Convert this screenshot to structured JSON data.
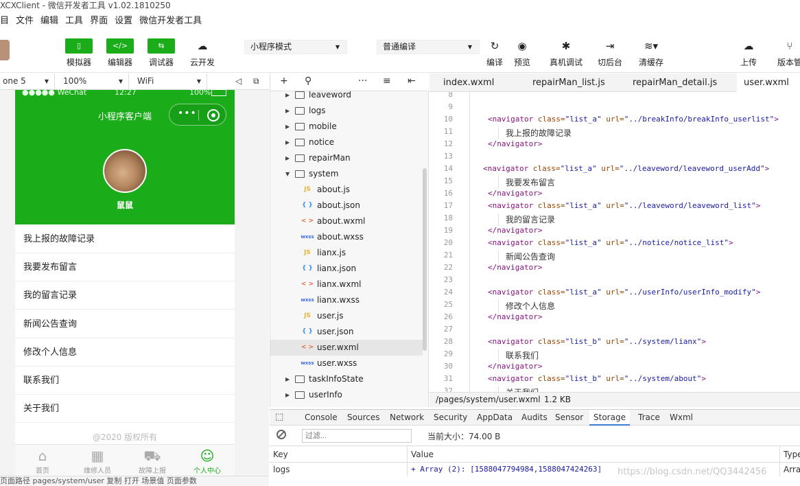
{
  "window": {
    "title": "XCXClient - 微信开发者工具 v1.02.1810250"
  },
  "menu": [
    "目",
    "文件",
    "编辑",
    "工具",
    "界面",
    "设置",
    "微信开发者工具"
  ],
  "toolbar": {
    "simulator": "模拟器",
    "editor": "编辑器",
    "debugger": "调试器",
    "cloud": "云开发",
    "mode_select": "小程序模式",
    "compile_select": "普通编译",
    "compile": "编译",
    "preview": "预览",
    "remote_debug": "真机调试",
    "background": "切后台",
    "clear_cache": "清缓存",
    "upload": "上传",
    "version": "版本管"
  },
  "simbar": {
    "device": "one 5",
    "zoom": "100%",
    "network": "WiFi"
  },
  "phone": {
    "status_left": "●●●●● WeChat",
    "status_time": "12:27",
    "status_battery": "100%",
    "nav_title": "小程序客户端",
    "user_name": "鼠鼠",
    "menu_items": [
      "我上报的故障记录",
      "我要发布留言",
      "我的留言记录",
      "新闻公告查询",
      "修改个人信息",
      "联系我们",
      "关于我们"
    ],
    "copyright": "@2020 版权所有",
    "tabs": [
      "首页",
      "维修人员",
      "故障上报",
      "个人中心"
    ]
  },
  "bottom_status": "页面路径  pages/system/user  复制  打开      场景值      页面参数",
  "tree": {
    "rows": [
      {
        "name": "leaveword",
        "type": "folder"
      },
      {
        "name": "logs",
        "type": "folder"
      },
      {
        "name": "mobile",
        "type": "folder"
      },
      {
        "name": "notice",
        "type": "folder"
      },
      {
        "name": "repairMan",
        "type": "folder"
      },
      {
        "name": "system",
        "type": "folder-open"
      },
      {
        "name": "about.js",
        "type": "js"
      },
      {
        "name": "about.json",
        "type": "json"
      },
      {
        "name": "about.wxml",
        "type": "wxml"
      },
      {
        "name": "about.wxss",
        "type": "wxss"
      },
      {
        "name": "lianx.js",
        "type": "js"
      },
      {
        "name": "lianx.json",
        "type": "json"
      },
      {
        "name": "lianx.wxml",
        "type": "wxml"
      },
      {
        "name": "lianx.wxss",
        "type": "wxss"
      },
      {
        "name": "user.js",
        "type": "js"
      },
      {
        "name": "user.json",
        "type": "json"
      },
      {
        "name": "user.wxml",
        "type": "wxml"
      },
      {
        "name": "user.wxss",
        "type": "wxss"
      },
      {
        "name": "taskInfoState",
        "type": "folder"
      },
      {
        "name": "userInfo",
        "type": "folder"
      }
    ],
    "selected": "user.wxml"
  },
  "editor": {
    "tabs": [
      "index.wxml",
      "repairMan_list.js",
      "repairMan_detail.js",
      "user.wxml"
    ],
    "active_tab": "user.wxml",
    "lines": [
      {
        "n": "8",
        "kind": "blank"
      },
      {
        "n": "9",
        "kind": "blank"
      },
      {
        "n": "10",
        "kind": "open",
        "cls": "list_a",
        "url": "../breakInfo/breakInfo_userlist"
      },
      {
        "n": "11",
        "kind": "text",
        "text": "我上报的故障记录"
      },
      {
        "n": "12",
        "kind": "close"
      },
      {
        "n": "13",
        "kind": "blank"
      },
      {
        "n": "14",
        "kind": "open",
        "cls": "list_a",
        "url": "../leaveword/leaveword_userAdd",
        "shift": true
      },
      {
        "n": "15",
        "kind": "text",
        "text": "我要发布留言"
      },
      {
        "n": "16",
        "kind": "close"
      },
      {
        "n": "17",
        "kind": "open",
        "cls": "list_a",
        "url": "../leaveword/leaveword_list"
      },
      {
        "n": "18",
        "kind": "text",
        "text": "我的留言记录"
      },
      {
        "n": "19",
        "kind": "close"
      },
      {
        "n": "20",
        "kind": "open",
        "cls": "list_a",
        "url": "../notice/notice_list"
      },
      {
        "n": "21",
        "kind": "text",
        "text": "新闻公告查询"
      },
      {
        "n": "22",
        "kind": "close"
      },
      {
        "n": "23",
        "kind": "blank"
      },
      {
        "n": "24",
        "kind": "open",
        "cls": "list_a",
        "url": "../userInfo/userInfo_modify"
      },
      {
        "n": "25",
        "kind": "text",
        "text": "修改个人信息"
      },
      {
        "n": "26",
        "kind": "close"
      },
      {
        "n": "27",
        "kind": "blank"
      },
      {
        "n": "28",
        "kind": "open",
        "cls": "list_b",
        "url": "../system/lianx"
      },
      {
        "n": "29",
        "kind": "text",
        "text": "联系我们"
      },
      {
        "n": "30",
        "kind": "close"
      },
      {
        "n": "31",
        "kind": "open",
        "cls": "list_b",
        "url": "../system/about"
      },
      {
        "n": "32",
        "kind": "text",
        "text": "关于我们"
      }
    ],
    "status_path": "/pages/system/user.wxml",
    "status_size": "1.2 KB"
  },
  "devtools": {
    "tabs": [
      "Console",
      "Sources",
      "Network",
      "Security",
      "AppData",
      "Audits",
      "Sensor",
      "Storage",
      "Trace",
      "Wxml"
    ],
    "active_tab": "Storage",
    "filter_placeholder": "过滤...",
    "current_size": "当前大小：74.00 B",
    "columns": [
      "Key",
      "Value",
      "Type"
    ],
    "rows": [
      {
        "key": "logs",
        "value": "+ Array (2): [1588047794984,1588047424263]",
        "type": "Array"
      }
    ]
  },
  "watermark": "https://blog.csdn.net/QQ3442456",
  "colors": {
    "accent": "#1aad19",
    "tag": "#881280",
    "attr": "#994500",
    "value": "#1a1aa6"
  }
}
